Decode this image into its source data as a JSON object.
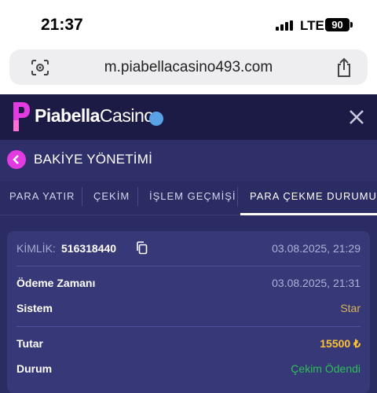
{
  "status_bar": {
    "time": "21:37",
    "network": "LTE",
    "battery": "90"
  },
  "browser": {
    "url": "m.piabellacasino493.com"
  },
  "site": {
    "logo_bold": "Piabella",
    "logo_light": "Casino",
    "brand_color": "#e23be0",
    "online_dot_color": "#5aa2e6"
  },
  "section": {
    "title": "BAKİYE YÖNETİMİ"
  },
  "tabs": [
    {
      "label": "PARA YATIR",
      "active": false
    },
    {
      "label": "ÇEKİM",
      "active": false
    },
    {
      "label": "İŞLEM GEÇMİŞİ",
      "active": false
    },
    {
      "label": "PARA ÇEKME DURUMU",
      "active": true
    }
  ],
  "withdrawal": {
    "id_label": "KİMLİK:",
    "id_value": "516318440",
    "created_at": "03.08.2025, 21:29",
    "payment_time_label": "Ödeme Zamanı",
    "payment_time": "03.08.2025, 21:31",
    "system_label": "Sistem",
    "system_value": "Star",
    "amount_label": "Tutar",
    "amount_value": "15500 ₺",
    "status_label": "Durum",
    "status_value": "Çekim Ödendi",
    "status_color": "#2dbf57",
    "amount_color": "#ffc233"
  }
}
